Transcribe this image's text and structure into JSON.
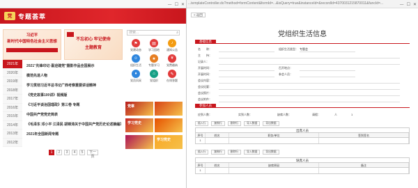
{
  "left_window": {
    "site_title": "专题荟萃",
    "logo_glyph": "党",
    "banner1": {
      "line1": "习近平",
      "line2": "新时代中国特色社会主义思想"
    },
    "banner2": {
      "line1": "不忘初心 牢记使命",
      "line2": "主题教育"
    },
    "search_placeholder": "搜索...",
    "icons": [
      {
        "label": "党建动态",
        "color": "#e23b3b",
        "icon": "flag-icon",
        "glyph": "⚑"
      },
      {
        "label": "学习园地",
        "color": "#e23b3b",
        "icon": "book-icon",
        "glyph": "▤"
      },
      {
        "label": "通知公告",
        "color": "#f39c12",
        "icon": "bell-icon",
        "glyph": "♪"
      },
      {
        "label": "组织生活",
        "color": "#2e86de",
        "icon": "people-icon",
        "glyph": "☺"
      },
      {
        "label": "专题学习",
        "color": "#e67e22",
        "icon": "star-icon",
        "glyph": "★"
      },
      {
        "label": "党费缴纳",
        "color": "#e23b3b",
        "icon": "coin-icon",
        "glyph": "¥"
      },
      {
        "label": "党员风采",
        "color": "#2e86de",
        "icon": "user-icon",
        "glyph": "♦"
      },
      {
        "label": "党组织",
        "color": "#16a085",
        "icon": "home-icon",
        "glyph": "⌂"
      },
      {
        "label": "在线答题",
        "color": "#e23b3b",
        "icon": "edit-icon",
        "glyph": "✎"
      }
    ],
    "years": [
      "2021年",
      "2020年",
      "2019年",
      "2018年",
      "2017年",
      "2016年",
      "2015年",
      "2014年",
      "2013年",
      "2012年"
    ],
    "active_year_index": 0,
    "news": [
      {
        "text": "2021\"先锋印记·喜迎建党\"摄影作品全国展示",
        "bold": true
      },
      {
        "text": "模范先进人物",
        "bold": true
      },
      {
        "text": "学习贯彻习近平总书记广西考察重要讲话精神",
        "bold": true
      },
      {
        "text": "《党史故事100讲》视频版",
        "bold": true
      },
      {
        "text": "《习近平谈治国理政》第三卷 专题",
        "bold": true
      },
      {
        "text": "中国共产党党史简表",
        "bold": true
      },
      {
        "text": "《毛泽东 邓小平 江泽民 胡锦涛关于中国共产党历史论述摘编》",
        "bold": true
      },
      {
        "text": "2021年全国新闻专题",
        "bold": true
      }
    ],
    "pagination": {
      "pages": [
        "1",
        "2",
        "3",
        "4",
        "5"
      ],
      "active": "1",
      "next_label": "下一页"
    },
    "side_images": [
      {
        "text": "党章",
        "color": "#b71c1c"
      },
      {
        "text": "",
        "color": "#d84315"
      },
      {
        "text": "学习党史",
        "color": "#c62828"
      },
      {
        "text": "",
        "color": "#e65100"
      },
      {
        "text": "",
        "color": "#ad1457"
      },
      {
        "text": "学习党史",
        "color": "#f9a825"
      }
    ]
  },
  "right_window": {
    "url": "...templateController.do?method=formContent&formId=...&isQuery=true&instanceId=&recordId=4370031215870011&funcId=...",
    "back_label": "< 返回",
    "page_title": "党组织生活信息",
    "section1_label": "基础信息",
    "fields": [
      {
        "label": "名　　称：",
        "value": ""
      },
      {
        "label": "组织生活类型：",
        "value": "专题会"
      },
      {
        "label": "主　　持：",
        "value": ""
      },
      {
        "label": "记录人：",
        "value": ""
      },
      {
        "label": "开展时间：",
        "value": ""
      },
      {
        "label": "召开地点：",
        "value": ""
      },
      {
        "label": "开展时间：",
        "value": ""
      },
      {
        "label": "参会人员：",
        "value": ""
      },
      {
        "label": "会议内容：",
        "value": ""
      },
      {
        "label": "会议纪要：",
        "value": ""
      },
      {
        "label": "会议照片：",
        "value": ""
      },
      {
        "label": "会议附件：",
        "value": ""
      }
    ],
    "section2_label": "参加人员",
    "attend_labels": [
      "应到人数：",
      "实到人数：",
      "缺席人数：",
      "请假：",
      "人"
    ],
    "attend_values": [
      "",
      "",
      "",
      "",
      "1"
    ],
    "buttons": [
      "插入行",
      "复制行",
      "删除行",
      "导入数据",
      "导出数据"
    ],
    "table1": {
      "title": "出席人员",
      "headers": [
        "序号",
        "姓名",
        "职务/单位",
        "签到签名"
      ],
      "row": [
        "1",
        "",
        "",
        ""
      ]
    },
    "table2": {
      "title": "缺席人员",
      "headers": [
        "序号",
        "姓名",
        "缺席原因",
        "备注"
      ],
      "row": [
        "1",
        "",
        "",
        ""
      ]
    }
  },
  "window_controls": {
    "minimize": "—",
    "maximize": "☐",
    "close": "✕"
  }
}
